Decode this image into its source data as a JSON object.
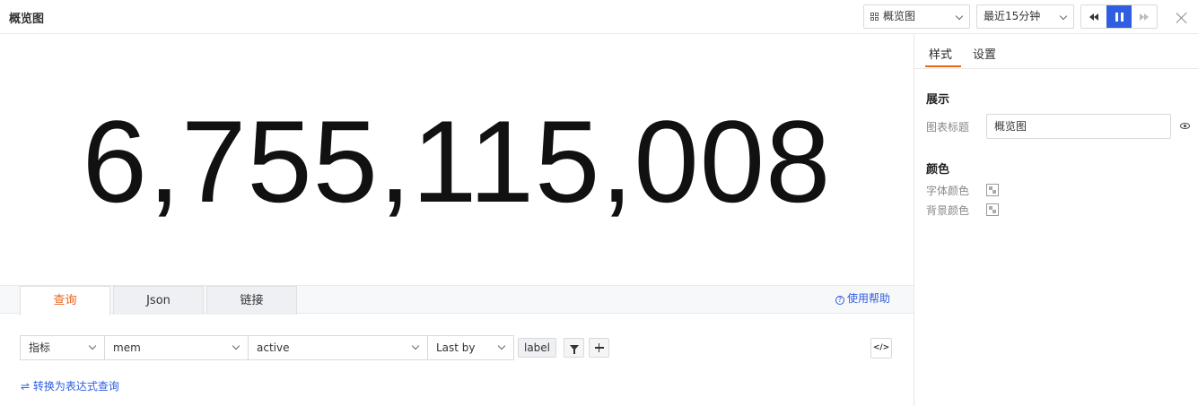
{
  "header": {
    "title": "概览图",
    "visualization_select": "概览图",
    "time_range_select": "最近15分钟"
  },
  "main": {
    "value": "6,755,115,008"
  },
  "query": {
    "tabs": [
      {
        "label": "查询",
        "active": true
      },
      {
        "label": "Json",
        "active": false
      },
      {
        "label": "链接",
        "active": false
      }
    ],
    "help_link": "使用帮助",
    "metric_type": "指标",
    "metric": "mem",
    "field": "active",
    "aggregation": "Last by",
    "group_tag": "label",
    "code_icon": "</>",
    "convert_link": "转换为表达式查询"
  },
  "panel": {
    "tabs": [
      {
        "label": "样式",
        "active": true
      },
      {
        "label": "设置",
        "active": false
      }
    ],
    "display_section": "展示",
    "chart_title_label": "图表标题",
    "chart_title_value": "概览图",
    "color_section": "颜色",
    "font_color_label": "字体颜色",
    "bg_color_label": "背景颜色"
  },
  "colors": {
    "accent": "#e8641b",
    "primary": "#2f5ee0"
  }
}
